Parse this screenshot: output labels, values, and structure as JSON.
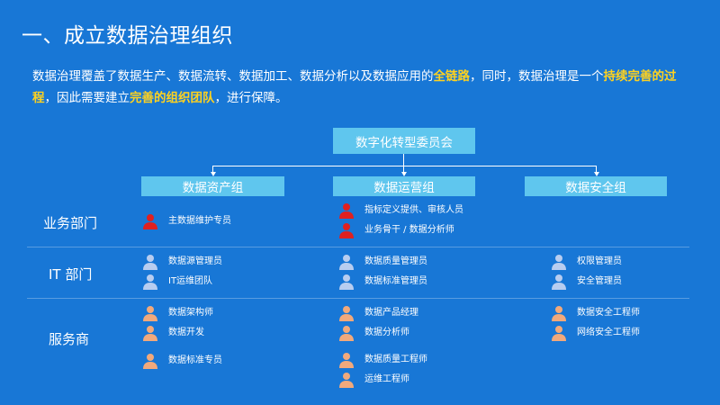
{
  "title": "一、成立数据治理组织",
  "intro": {
    "t1": "数据治理覆盖了数据生产、数据流转、数据加工、数据分析以及数据应用的",
    "h1": "全链路",
    "t2": "，同时，数据治理是一个",
    "h2": "持续完善的过",
    "h3": "程",
    "t3": "，因此需要建立",
    "h4": "完善的组织团队",
    "t4": "，进行保障。"
  },
  "colors": {
    "background": "#1877d6",
    "box": "#5fc6ee",
    "highlight": "#ffd21f",
    "icon_red": "#e02020",
    "icon_blue": "#b8cdf0",
    "icon_orange": "#f1a97c"
  },
  "committee": "数字化转型委员会",
  "groups": [
    "数据资产组",
    "数据运营组",
    "数据安全组"
  ],
  "row_labels": [
    "业务部门",
    "IT 部门",
    "服务商"
  ],
  "roles": {
    "business": {
      "asset": [
        "主数据维护专员"
      ],
      "ops": [
        "指标定义提供、审核人员",
        "业务骨干 / 数据分析师"
      ]
    },
    "it": {
      "asset": [
        "数据源管理员",
        "IT运维团队"
      ],
      "ops": [
        "数据质量管理员",
        "数据标准管理员"
      ],
      "security": [
        "权限管理员",
        "安全管理员"
      ]
    },
    "vendor": {
      "asset": [
        "数据架构师",
        "数据开发",
        "数据标准专员"
      ],
      "ops": [
        "数据产品经理",
        "数据分析师",
        "数据质量工程师",
        "运维工程师"
      ],
      "security": [
        "数据安全工程师",
        "网络安全工程师"
      ]
    }
  },
  "icons": {
    "person": "person-icon"
  }
}
